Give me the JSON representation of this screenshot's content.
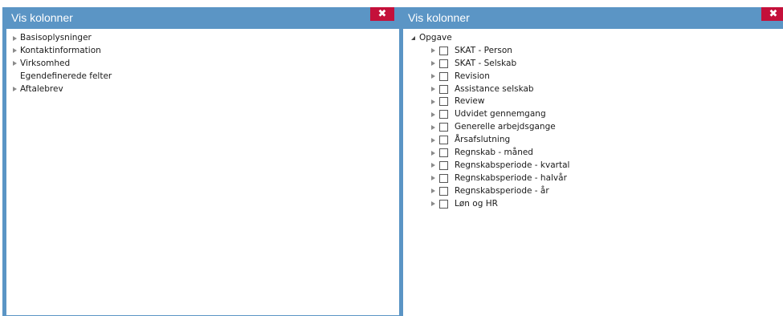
{
  "left_panel": {
    "title": "Vis kolonner",
    "close_glyph": "✖",
    "items": [
      {
        "label": "Basisoplysninger",
        "expandable": true
      },
      {
        "label": "Kontaktinformation",
        "expandable": true
      },
      {
        "label": "Virksomhed",
        "expandable": true
      },
      {
        "label": "Egendefinerede felter",
        "expandable": false
      },
      {
        "label": "Aftalebrev",
        "expandable": true
      }
    ]
  },
  "right_panel": {
    "title": "Vis kolonner",
    "close_glyph": "✖",
    "root": {
      "label": "Opgave",
      "expanded": true
    },
    "children": [
      {
        "label": "SKAT - Person",
        "checked": false
      },
      {
        "label": "SKAT - Selskab",
        "checked": false
      },
      {
        "label": "Revision",
        "checked": false
      },
      {
        "label": "Assistance selskab",
        "checked": false
      },
      {
        "label": "Review",
        "checked": false
      },
      {
        "label": "Udvidet gennemgang",
        "checked": false
      },
      {
        "label": "Generelle arbejdsgange",
        "checked": false
      },
      {
        "label": "Årsafslutning",
        "checked": false
      },
      {
        "label": "Regnskab - måned",
        "checked": false
      },
      {
        "label": "Regnskabsperiode - kvartal",
        "checked": false
      },
      {
        "label": "Regnskabsperiode - halvår",
        "checked": false
      },
      {
        "label": "Regnskabsperiode - år",
        "checked": false
      },
      {
        "label": "Løn og HR",
        "checked": false
      }
    ]
  },
  "colors": {
    "titlebar": "#5b95c5",
    "close": "#c4103a"
  },
  "icons": {
    "expand": "triangle-right-icon",
    "collapse": "triangle-down-icon",
    "close": "close-icon"
  }
}
